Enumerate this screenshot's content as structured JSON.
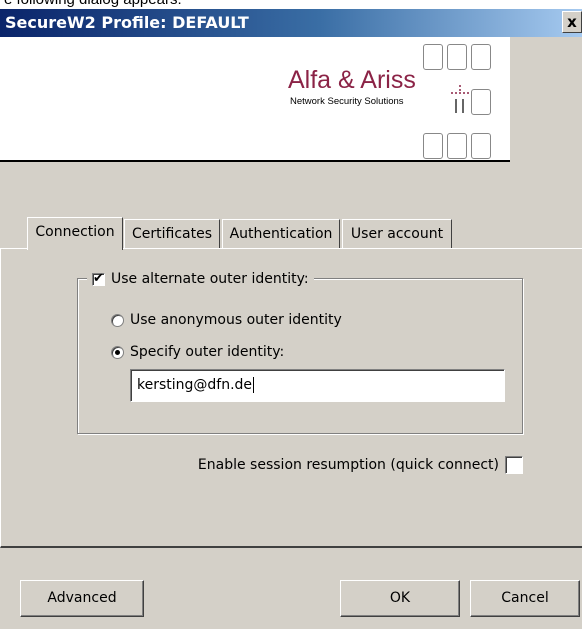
{
  "doc_caption": "e following dialog appears:",
  "window": {
    "title": "SecureW2 Profile: DEFAULT",
    "close_label": "x"
  },
  "banner": {
    "logo_name": "Alfa & Ariss",
    "logo_tagline": "Network Security Solutions",
    "logo_icon": "alfa-ariss-logo"
  },
  "tabs": [
    {
      "label": "Connection",
      "active": true
    },
    {
      "label": "Certificates",
      "active": false
    },
    {
      "label": "Authentication",
      "active": false
    },
    {
      "label": "User account",
      "active": false
    }
  ],
  "connection": {
    "alternate_identity": {
      "label": "Use alternate outer identity:",
      "checked": true
    },
    "radio_anonymous": {
      "label": "Use anonymous outer identity",
      "selected": false
    },
    "radio_specify": {
      "label": "Specify outer identity:",
      "selected": true
    },
    "outer_identity_value": "kersting@dfn.de",
    "session_resumption": {
      "label": "Enable session resumption (quick connect)",
      "checked": false
    }
  },
  "buttons": {
    "advanced": "Advanced",
    "ok": "OK",
    "cancel": "Cancel"
  },
  "colors": {
    "title_bar_start": "#0a246a",
    "title_bar_end": "#a6caf0",
    "dialog_face": "#d4d0c8",
    "logo_accent": "#8b2346"
  }
}
